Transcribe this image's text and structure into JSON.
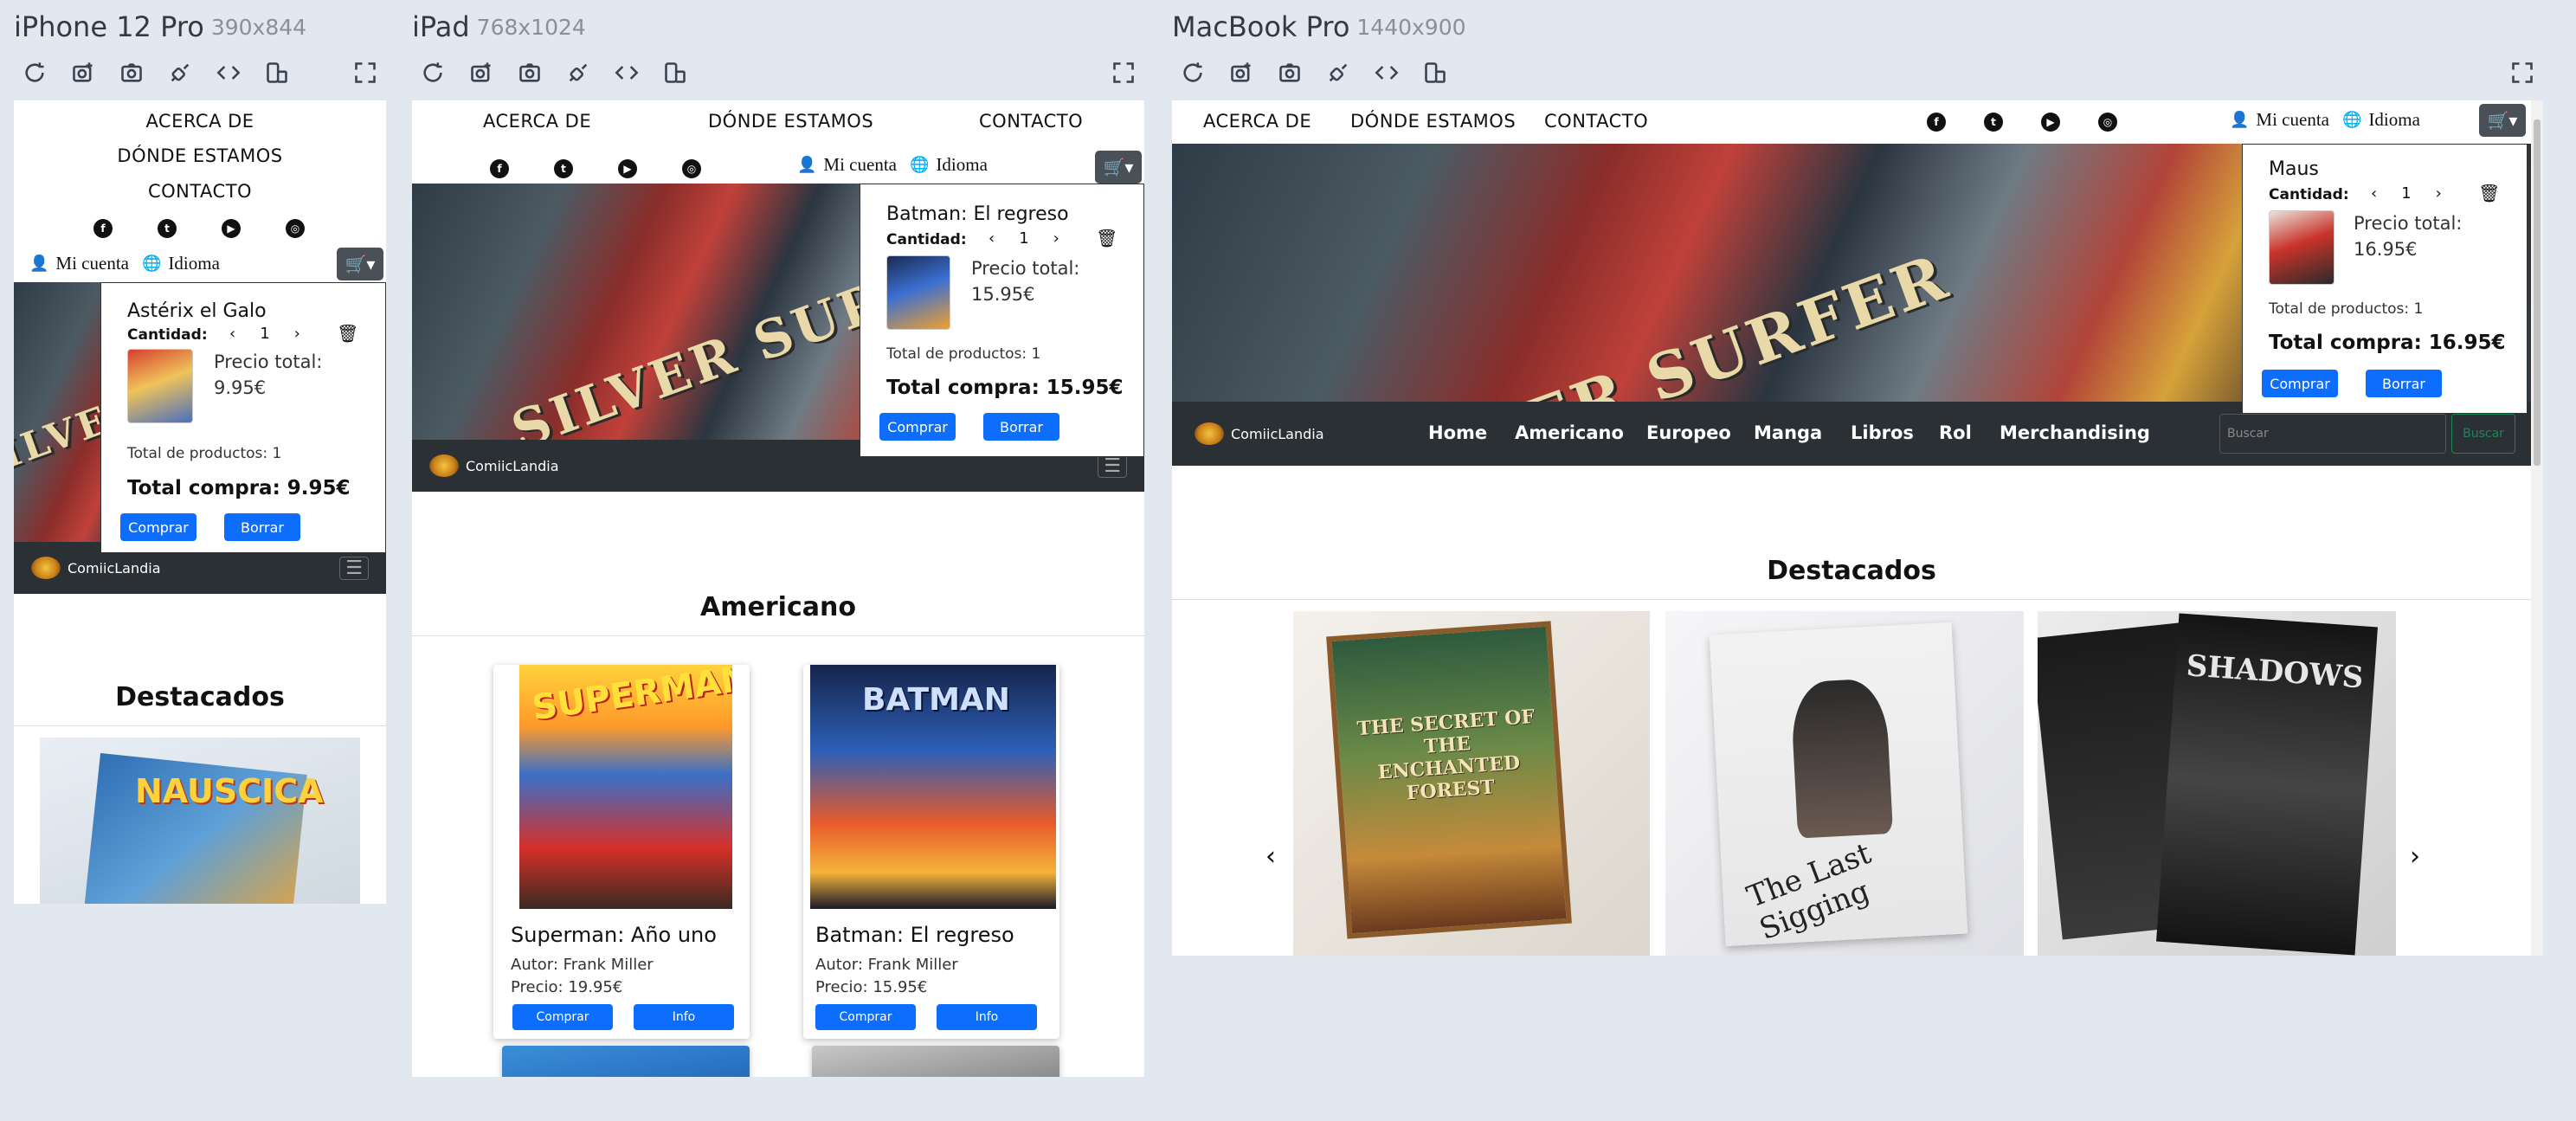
{
  "frames": [
    {
      "name": "iPhone 12 Pro",
      "dims": "390x844"
    },
    {
      "name": "iPad",
      "dims": "768x1024"
    },
    {
      "name": "MacBook Pro",
      "dims": "1440x900"
    }
  ],
  "toolbar_icons": [
    "refresh-icon",
    "screenshot-icon",
    "camera-icon",
    "network-icon",
    "code-icon",
    "rotate-device-icon"
  ],
  "nav": {
    "about": "ACERCA DE",
    "where": "DÓNDE ESTAMOS",
    "contact": "CONTACTO"
  },
  "account": {
    "my_account": "Mi cuenta",
    "language": "Idioma"
  },
  "brand": "ComiicLandia",
  "cart": {
    "quantity_label": "Cantidad:",
    "price_label": "Precio total:",
    "total_items_label": "Total de productos: 1",
    "buy_label": "Comprar",
    "clear_label": "Borrar",
    "iphone": {
      "title": "Astérix el Galo",
      "qty": "1",
      "price": "9.95€",
      "total": "Total compra: 9.95€"
    },
    "ipad": {
      "title": "Batman: El regreso",
      "qty": "1",
      "price": "15.95€",
      "total": "Total compra: 15.95€"
    },
    "mac": {
      "title": "Maus",
      "qty": "1",
      "price": "16.95€",
      "total": "Total compra: 16.95€"
    }
  },
  "hero_word": "SILVER SURFER",
  "sections": {
    "featured": "Destacados",
    "american": "Americano"
  },
  "mac_menu": [
    "Home",
    "Americano",
    "Europeo",
    "Manga",
    "Libros",
    "Rol",
    "Merchandising"
  ],
  "search": {
    "placeholder": "Buscar",
    "button": "Buscar"
  },
  "products": [
    {
      "title": "Superman: Año uno",
      "author": "Autor: Frank Miller",
      "price": "Precio: 19.95€",
      "cover": "SUPERMAN",
      "buy": "Comprar",
      "info": "Info"
    },
    {
      "title": "Batman: El regreso",
      "author": "Autor: Frank Miller",
      "price": "Precio: 15.95€",
      "cover": "BATMAN",
      "buy": "Comprar",
      "info": "Info"
    }
  ],
  "iphone_featured_cover": "NAUSCICA",
  "carousel": [
    {
      "title": "THE SECRET OF THE ENCHANTED FOREST"
    },
    {
      "title": "The Last Sigging"
    },
    {
      "title": "SHADOWS"
    }
  ],
  "colors": {
    "blue": "#0d6efd",
    "dark": "#2b3035",
    "bg": "#e2e8f0"
  }
}
